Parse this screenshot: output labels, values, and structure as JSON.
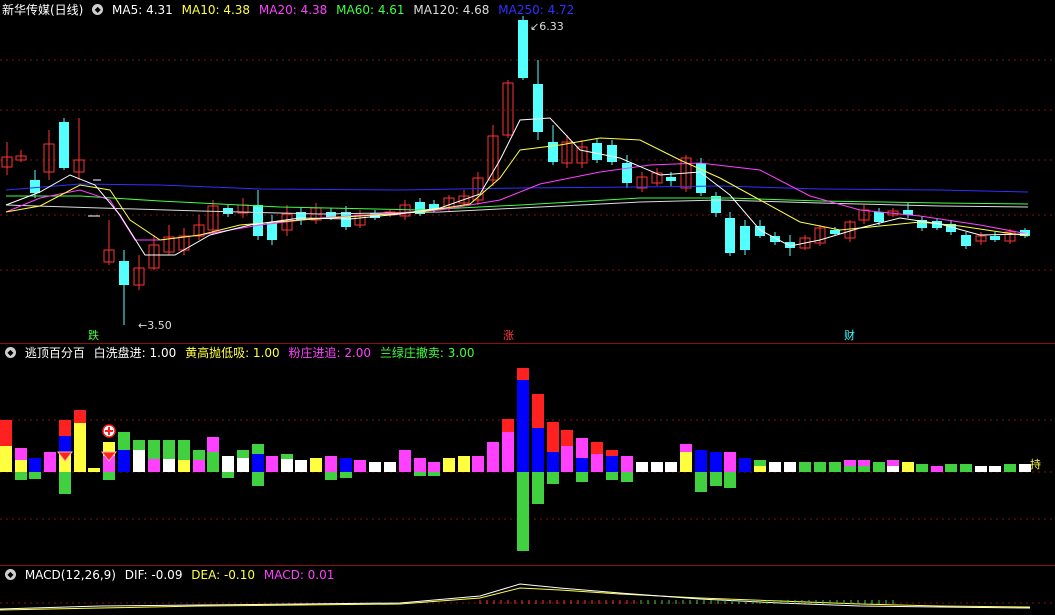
{
  "main_legend": {
    "title": "新华传媒(日线)",
    "items": [
      {
        "text": "MA5: 4.31",
        "color": "#ffffff"
      },
      {
        "text": "MA10: 4.38",
        "color": "#ffff40"
      },
      {
        "text": "MA20: 4.38",
        "color": "#ff40ff"
      },
      {
        "text": "MA60: 4.61",
        "color": "#40ff40"
      },
      {
        "text": "MA120: 4.68",
        "color": "#dcdcdc"
      },
      {
        "text": "MA250: 4.72",
        "color": "#3030ff"
      }
    ]
  },
  "price_marks": {
    "high": "6.33",
    "low": "3.50"
  },
  "event_labels": [
    {
      "text": "跌",
      "color": "#40ff40"
    },
    {
      "text": "涨",
      "color": "#ff4040"
    },
    {
      "text": "财",
      "color": "#40ffff"
    }
  ],
  "indicator_legend": {
    "title": "逃顶百分百",
    "items": [
      {
        "text": "白洗盘进: 1.00",
        "color": "#ffffff"
      },
      {
        "text": "黄高抛低吸: 1.00",
        "color": "#ffff40"
      },
      {
        "text": "粉庄进追: 2.00",
        "color": "#ff40ff"
      },
      {
        "text": "兰绿庄撤卖: 3.00",
        "color": "#40ff40"
      }
    ]
  },
  "indicator_side_label": "持",
  "macd_legend": {
    "title": "MACD(12,26,9)",
    "items": [
      {
        "text": "DIF: -0.09",
        "color": "#ffffff"
      },
      {
        "text": "DEA: -0.10",
        "color": "#ffff40"
      },
      {
        "text": "MACD: 0.01",
        "color": "#ff40ff"
      }
    ]
  },
  "colors": {
    "up": "#ff3232",
    "down": "#54ffff",
    "grid": "#8a1010"
  }
}
